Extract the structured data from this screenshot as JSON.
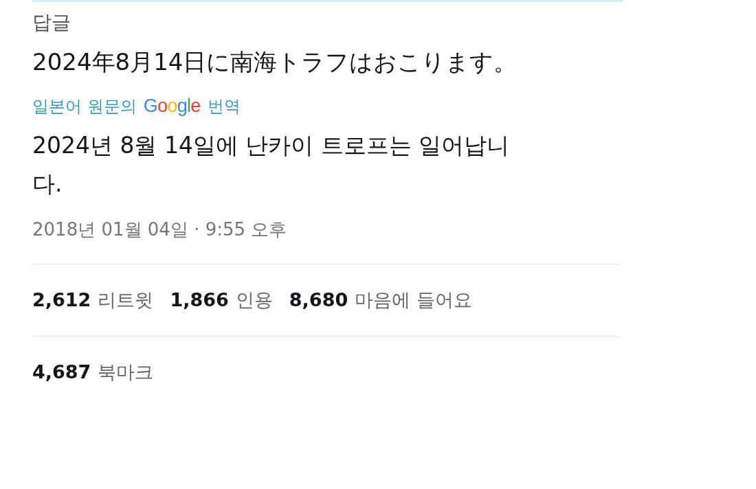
{
  "reply_label": "답글",
  "tweet_text": "2024年8月14日に南海トラフはおこります。",
  "translation_label": {
    "prefix": "일본어 원문의",
    "brand": "Google",
    "suffix": "번역"
  },
  "translated_text": "2024년 8월 14일에 난카이 트로프는 일어납니다.",
  "timestamp": "2018년 01월 04일 · 9:55 오후",
  "stats": [
    {
      "count": "2,612",
      "label": "리트윗"
    },
    {
      "count": "1,866",
      "label": "인용"
    },
    {
      "count": "8,680",
      "label": "마음에 들어요"
    }
  ],
  "bookmarks": {
    "count": "4,687",
    "label": "북마크"
  }
}
